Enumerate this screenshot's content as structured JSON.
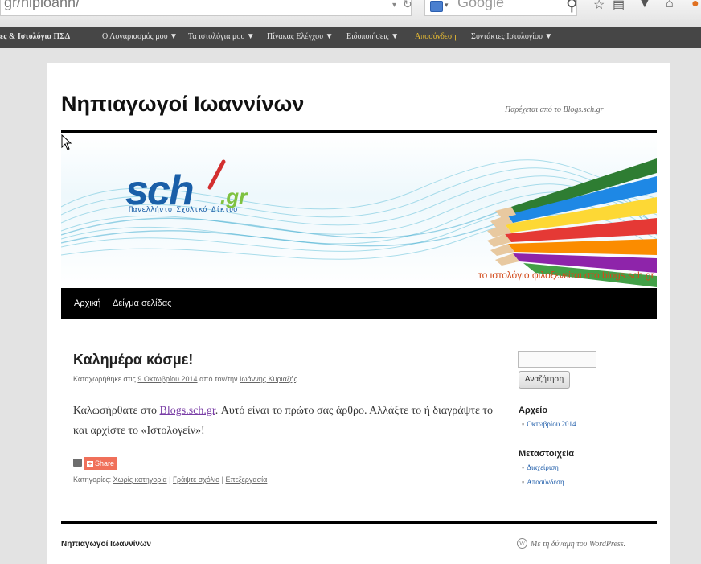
{
  "browser": {
    "url_text": "gr/hipioanh/",
    "search_placeholder": "Google",
    "icons": [
      "search-engine-icon",
      "search-icon",
      "star-icon",
      "bookmarks-icon",
      "download-icon",
      "home-icon"
    ]
  },
  "admin_bar": {
    "items": [
      "ες & Ιστολόγια ΠΣΔ",
      "Ο Λογαριασμός μου ▼",
      "Τα ιστολόγια μου ▼",
      "Πίνακας Ελέγχου ▼",
      "Ειδοποιήσεις ▼",
      "Αποσύνδεση",
      "Συντάκτες Ιστολογίου ▼"
    ]
  },
  "site": {
    "title": "Νηπιαγωγοί Ιωαννίνων",
    "powered_by": "Παρέχεται από το Blogs.sch.gr"
  },
  "banner": {
    "logo": "sch",
    "logo_tld": ".gr",
    "logo_subtitle": "Πανελλήνιο Σχολικό Δίκτυο",
    "caption": "το ιστολόγιο φιλοξενείται στο blogs.sch.gr"
  },
  "nav": {
    "items": [
      "Αρχική",
      "Δείγμα σελίδας"
    ]
  },
  "post": {
    "title": "Καλημέρα κόσμε!",
    "meta_prefix": "Καταχωρήθηκε στις",
    "meta_date": "9 Οκτωβρίου 2014",
    "meta_by": "από τον/την",
    "meta_author": "Ιωάννης Κυριαζής",
    "body_pre": "Καλωσήρθατε στο",
    "body_link": "Blogs.sch.gr",
    "body_post": ". Αυτό είναι το πρώτο σας άρθρο. Αλλάξτε το ή διαγράψτε το και αρχίστε το «Ιστολογείν»!",
    "share_label": "Share",
    "categories_label": "Κατηγορίες:",
    "category": "Χωρίς κατηγορία",
    "sep1": "|",
    "comment_link": "Γράψτε σχόλιο",
    "sep2": "|",
    "edit_link": "Επεξεργασία"
  },
  "sidebar": {
    "search_value": "",
    "search_button": "Αναζήτηση",
    "archive_heading": "Αρχείο",
    "archive_items": [
      "Οκτωβρίου 2014"
    ],
    "meta_heading": "Μεταστοιχεία",
    "meta_items": [
      "Διαχείριση",
      "Αποσύνδεση"
    ]
  },
  "footer": {
    "title": "Νηπιαγωγοί Ιωαννίνων",
    "powered": "Με τη δύναμη του WordPress."
  },
  "colors": {
    "admin_bar": "#464646",
    "logout": "#f1c232",
    "nav_bar": "#000000",
    "share": "#f0705a",
    "link": "#1b5aa8"
  }
}
